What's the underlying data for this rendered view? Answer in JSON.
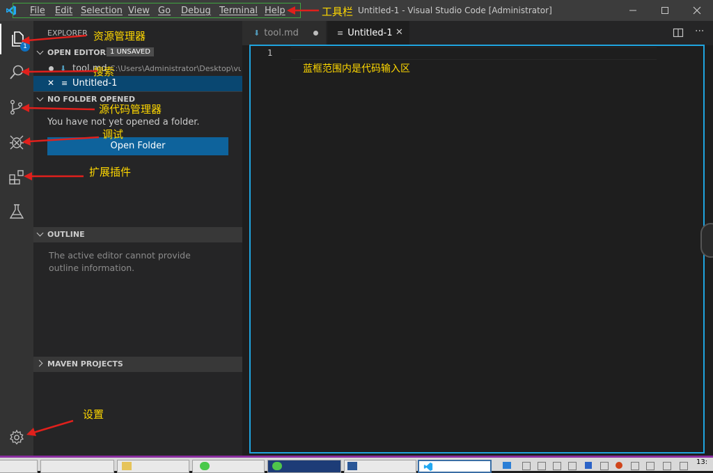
{
  "titlebar": {
    "menus": [
      "File",
      "Edit",
      "Selection",
      "View",
      "Go",
      "Debug",
      "Terminal",
      "Help"
    ],
    "toolbar_annotation": "工具栏",
    "window_title": "Untitled-1 - Visual Studio Code [Administrator]"
  },
  "activity": {
    "explorer_badge": "1",
    "annotations": {
      "explorer": "资源管理器",
      "search": "搜索",
      "scm": "源代码管理器",
      "debug": "调试",
      "extensions": "扩展插件",
      "settings": "设置"
    }
  },
  "sidebar": {
    "title": "EXPLORER",
    "open_editors": {
      "header": "OPEN EDITORS",
      "badge": "1 UNSAVED",
      "items": [
        {
          "name": "tool.md",
          "path": "C:\\Users\\Administrator\\Desktop\\vu..."
        },
        {
          "name": "Untitled-1"
        }
      ]
    },
    "no_folder": {
      "header": "NO FOLDER OPENED",
      "message": "You have not yet opened a folder.",
      "button": "Open Folder"
    },
    "outline": {
      "header": "OUTLINE",
      "message": "The active editor cannot provide outline information."
    },
    "maven": {
      "header": "MAVEN PROJECTS"
    }
  },
  "editor": {
    "tabs": [
      {
        "label": "tool.md",
        "dirty": true
      },
      {
        "label": "Untitled-1",
        "active": true
      }
    ],
    "line_number": "1",
    "area_annotation": "蓝框范围内是代码输入区"
  },
  "taskbar": {
    "clock": "13:"
  },
  "colors": {
    "annotation": "#ffd800",
    "arrow": "#e0201c",
    "frame": "#1fa5e0",
    "toolbar_frame": "#3fa63f",
    "accent_button": "#0e639c",
    "selection": "#094771"
  }
}
